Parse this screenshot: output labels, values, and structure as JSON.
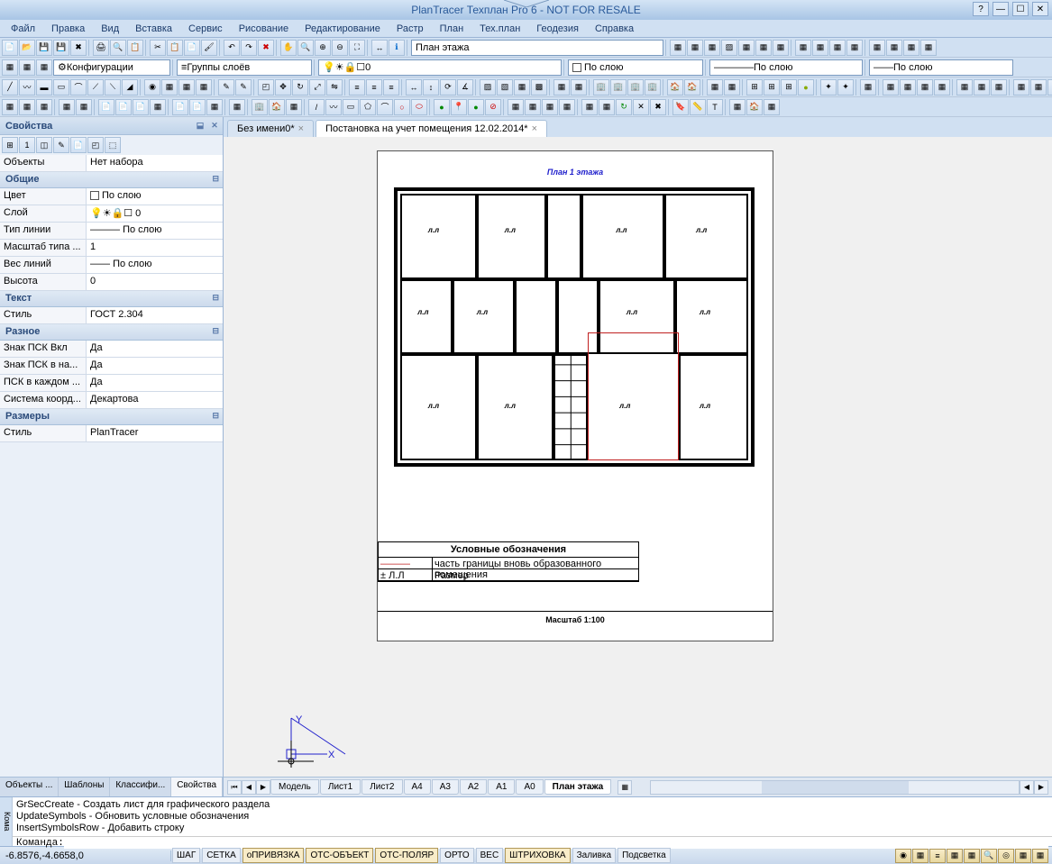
{
  "title": "PlanTracer Техплан Pro 6 - NOT FOR RESALE",
  "menu": [
    "Файл",
    "Правка",
    "Вид",
    "Вставка",
    "Сервис",
    "Рисование",
    "Редактирование",
    "Растр",
    "План",
    "Тех.план",
    "Геодезия",
    "Справка"
  ],
  "toolbar2": {
    "config_label": "Конфигурации",
    "layer_groups_label": "Группы слоёв",
    "layer_value": "0",
    "color_value": "По слою",
    "linetype_value": "По слою",
    "lineweight_value": "По слою",
    "plan_dropdown": "План этажа"
  },
  "properties_panel": {
    "title": "Свойства",
    "objects_label": "Объекты",
    "objects_value": "Нет набора",
    "sections": {
      "general": "Общие",
      "text": "Текст",
      "misc": "Разное",
      "dimensions": "Размеры"
    },
    "rows": {
      "color": {
        "label": "Цвет",
        "value": "По слою"
      },
      "layer": {
        "label": "Слой",
        "value": "0"
      },
      "linetype": {
        "label": "Тип линии",
        "value": "По слою"
      },
      "ltscale": {
        "label": "Масштаб типа ...",
        "value": "1"
      },
      "lineweight": {
        "label": "Вес линий",
        "value": "По слою"
      },
      "height": {
        "label": "Высота",
        "value": "0"
      },
      "textstyle": {
        "label": "Стиль",
        "value": "ГОСТ 2.304"
      },
      "ucs_on": {
        "label": "Знак ПСК Вкл",
        "value": "Да"
      },
      "ucs_origin": {
        "label": "Знак ПСК в на...",
        "value": "Да"
      },
      "ucs_each": {
        "label": "ПСК в каждом ...",
        "value": "Да"
      },
      "coord_system": {
        "label": "Система коорд...",
        "value": "Декартова"
      },
      "dim_style": {
        "label": "Стиль",
        "value": "PlanTracer"
      }
    },
    "tabs": [
      "Объекты ...",
      "Шаблоны",
      "Классифи...",
      "Свойства"
    ]
  },
  "doc_tabs": [
    {
      "label": "Без имени0*",
      "active": false
    },
    {
      "label": "Постановка на учет помещения 12.02.2014*",
      "active": true
    }
  ],
  "drawing": {
    "title": "План 1 этажа",
    "legend_title": "Условные обозначения",
    "legend_row1": "часть границы вновь образованного помещения",
    "legend_row2_label": "± Л.Л",
    "legend_row2": "Размер",
    "scale": "Масштаб 1:100",
    "axis_x": "X",
    "axis_y": "Y"
  },
  "view_tabs": [
    "Модель",
    "Лист1",
    "Лист2",
    "A4",
    "A3",
    "A2",
    "A1",
    "A0",
    "План этажа"
  ],
  "command": {
    "sidebar": "Кома",
    "line1": "GrSecCreate - Создать лист для графического раздела",
    "line2": "UpdateSymbols - Обновить условные обозначения",
    "line3": "InsertSymbolsRow - Добавить строку",
    "prompt": "Команда:"
  },
  "status": {
    "coords": "-6.8576,-4.6658,0",
    "toggles": [
      "ШАГ",
      "СЕТКА",
      "оПРИВЯЗКА",
      "ОТС-ОБЪЕКТ",
      "ОТС-ПОЛЯР",
      "ОРТО",
      "ВЕС",
      "ШТРИХОВКА",
      "Заливка",
      "Подсветка"
    ],
    "toggle_states": [
      false,
      false,
      true,
      true,
      true,
      false,
      false,
      true,
      false,
      false
    ]
  }
}
